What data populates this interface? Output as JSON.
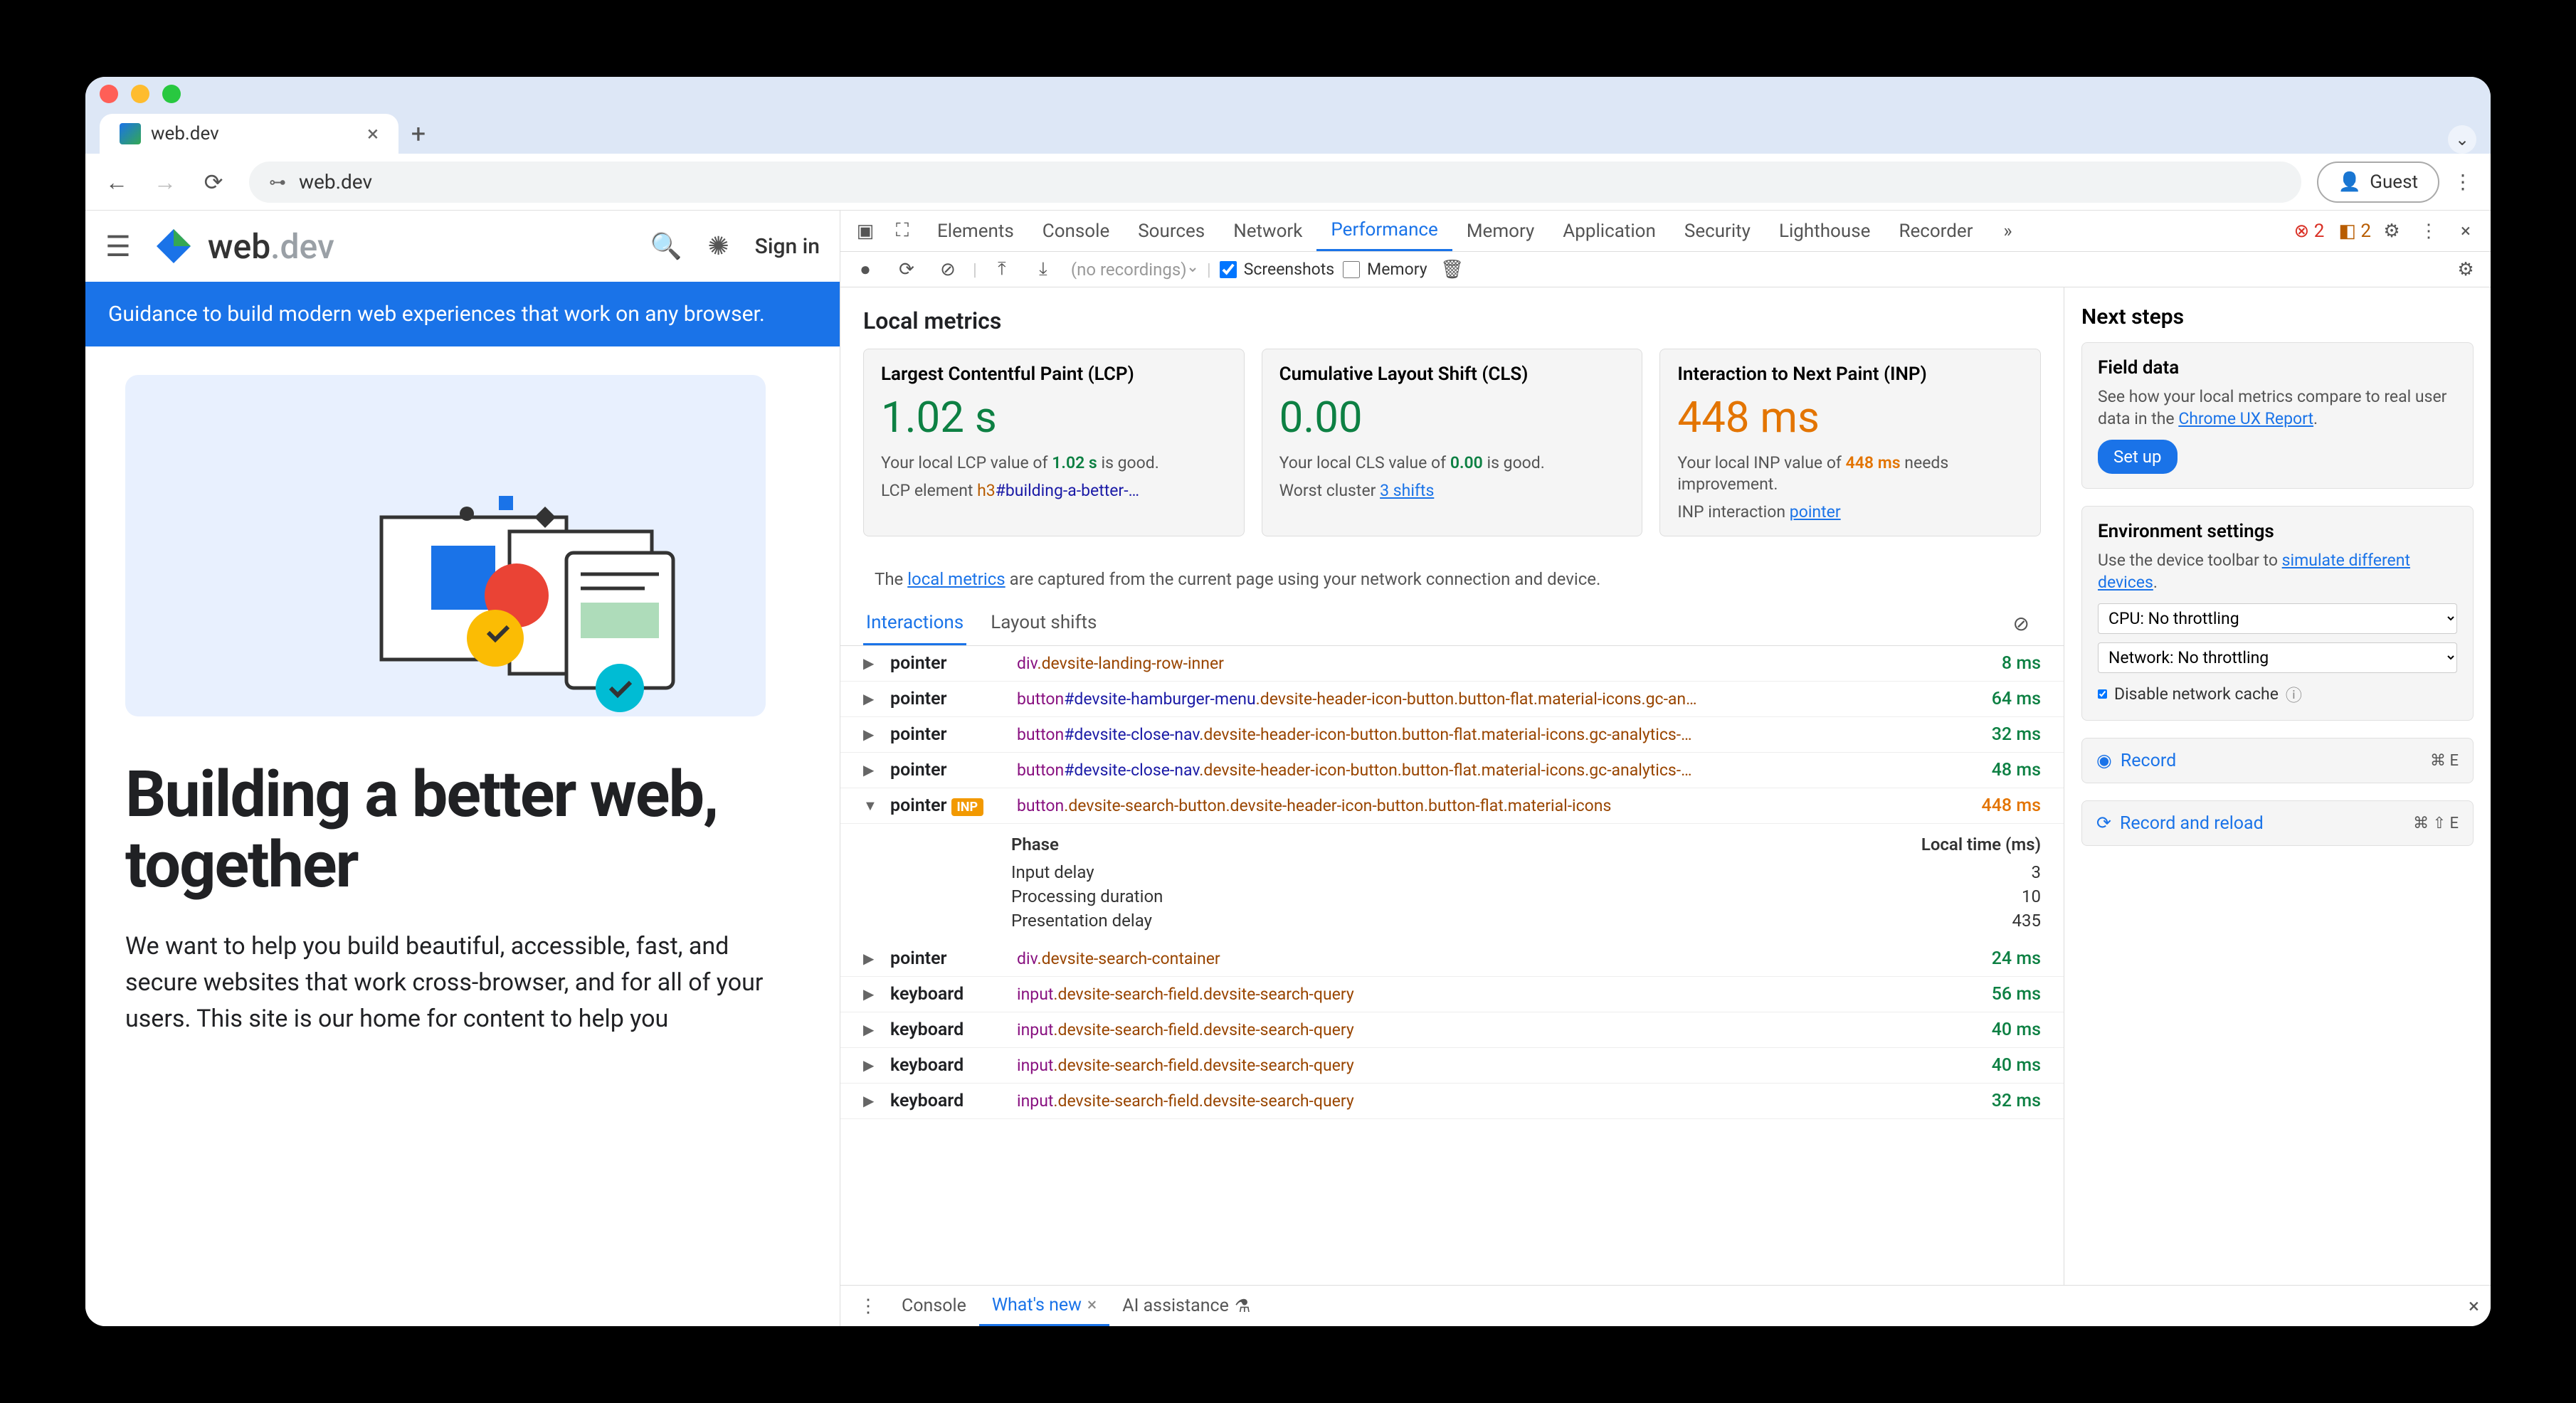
{
  "browser": {
    "tab_title": "web.dev",
    "url": "web.dev",
    "guest_label": "Guest"
  },
  "page": {
    "logo_text_pre": "web",
    "logo_text_suf": ".dev",
    "sign_in": "Sign in",
    "banner": "Guidance to build modern web experiences that work on any browser.",
    "h1": "Building a better web, together",
    "body": "We want to help you build beautiful, accessible, fast, and secure websites that work cross-browser, and for all of your users. This site is our home for content to help you"
  },
  "devtools": {
    "tabs": [
      "Elements",
      "Console",
      "Sources",
      "Network",
      "Performance",
      "Memory",
      "Application",
      "Security",
      "Lighthouse",
      "Recorder"
    ],
    "active_tab": "Performance",
    "errors": "2",
    "warnings": "2",
    "perfbar": {
      "recordings_placeholder": "(no recordings)",
      "screenshots_label": "Screenshots",
      "memory_label": "Memory"
    },
    "local_metrics_title": "Local metrics",
    "cards": {
      "lcp": {
        "title": "Largest Contentful Paint (LCP)",
        "value": "1.02 s",
        "desc_pre": "Your local LCP value of ",
        "desc_val": "1.02 s",
        "desc_post": " is good.",
        "sub_label": "LCP element ",
        "sub_tag": "h3",
        "sub_sel": "#building-a-better-…"
      },
      "cls": {
        "title": "Cumulative Layout Shift (CLS)",
        "value": "0.00",
        "desc_pre": "Your local CLS value of ",
        "desc_val": "0.00",
        "desc_post": " is good.",
        "sub_label": "Worst cluster ",
        "sub_link": "3 shifts"
      },
      "inp": {
        "title": "Interaction to Next Paint (INP)",
        "value": "448 ms",
        "desc_pre": "Your local INP value of ",
        "desc_val": "448 ms",
        "desc_post": " needs improvement.",
        "sub_label": "INP interaction ",
        "sub_link": "pointer"
      }
    },
    "notice_pre": "The ",
    "notice_link": "local metrics",
    "notice_post": " are captured from the current page using your network connection and device.",
    "interaction_tabs": [
      "Interactions",
      "Layout shifts"
    ],
    "phase_header_l": "Phase",
    "phase_header_r": "Local time (ms)",
    "phases": [
      {
        "name": "Input delay",
        "v": "3"
      },
      {
        "name": "Processing duration",
        "v": "10"
      },
      {
        "name": "Presentation delay",
        "v": "435"
      }
    ],
    "interactions": [
      {
        "type": "pointer",
        "el": "div",
        "cls": ".devsite-landing-row-inner",
        "dur": "8 ms",
        "good": true
      },
      {
        "type": "pointer",
        "el": "button",
        "id": "#devsite-hamburger-menu",
        "cls": ".devsite-header-icon-button.button-flat.material-icons.gc-an…",
        "dur": "64 ms",
        "good": true
      },
      {
        "type": "pointer",
        "el": "button",
        "id": "#devsite-close-nav",
        "cls": ".devsite-header-icon-button.button-flat.material-icons.gc-analytics-…",
        "dur": "32 ms",
        "good": true
      },
      {
        "type": "pointer",
        "el": "button",
        "id": "#devsite-close-nav",
        "cls": ".devsite-header-icon-button.button-flat.material-icons.gc-analytics-…",
        "dur": "48 ms",
        "good": true
      },
      {
        "type": "pointer",
        "el": "button",
        "cls": ".devsite-search-button.devsite-header-icon-button.button-flat.material-icons",
        "dur": "448 ms",
        "good": false,
        "expanded": true,
        "inp": true
      },
      {
        "type": "pointer",
        "el": "div",
        "cls": ".devsite-search-container",
        "dur": "24 ms",
        "good": true
      },
      {
        "type": "keyboard",
        "el": "input",
        "cls": ".devsite-search-field.devsite-search-query",
        "dur": "56 ms",
        "good": true
      },
      {
        "type": "keyboard",
        "el": "input",
        "cls": ".devsite-search-field.devsite-search-query",
        "dur": "40 ms",
        "good": true
      },
      {
        "type": "keyboard",
        "el": "input",
        "cls": ".devsite-search-field.devsite-search-query",
        "dur": "40 ms",
        "good": true
      },
      {
        "type": "keyboard",
        "el": "input",
        "cls": ".devsite-search-field.devsite-search-query",
        "dur": "32 ms",
        "good": true
      }
    ]
  },
  "side": {
    "title": "Next steps",
    "field_data_h": "Field data",
    "field_data_p_pre": "See how your local metrics compare to real user data in the ",
    "field_data_link": "Chrome UX Report",
    "setup_btn": "Set up",
    "env_h": "Environment settings",
    "env_p_pre": "Use the device toolbar to ",
    "env_link": "simulate different devices",
    "cpu_select": "CPU: No throttling",
    "net_select": "Network: No throttling",
    "disable_cache": "Disable network cache",
    "record": "Record",
    "record_sc": "⌘ E",
    "record_reload": "Record and reload",
    "record_reload_sc": "⌘ ⇧ E"
  },
  "drawer": {
    "tabs": [
      "Console",
      "What's new",
      "AI assistance"
    ],
    "active": "What's new"
  },
  "inp_badge": "INP"
}
